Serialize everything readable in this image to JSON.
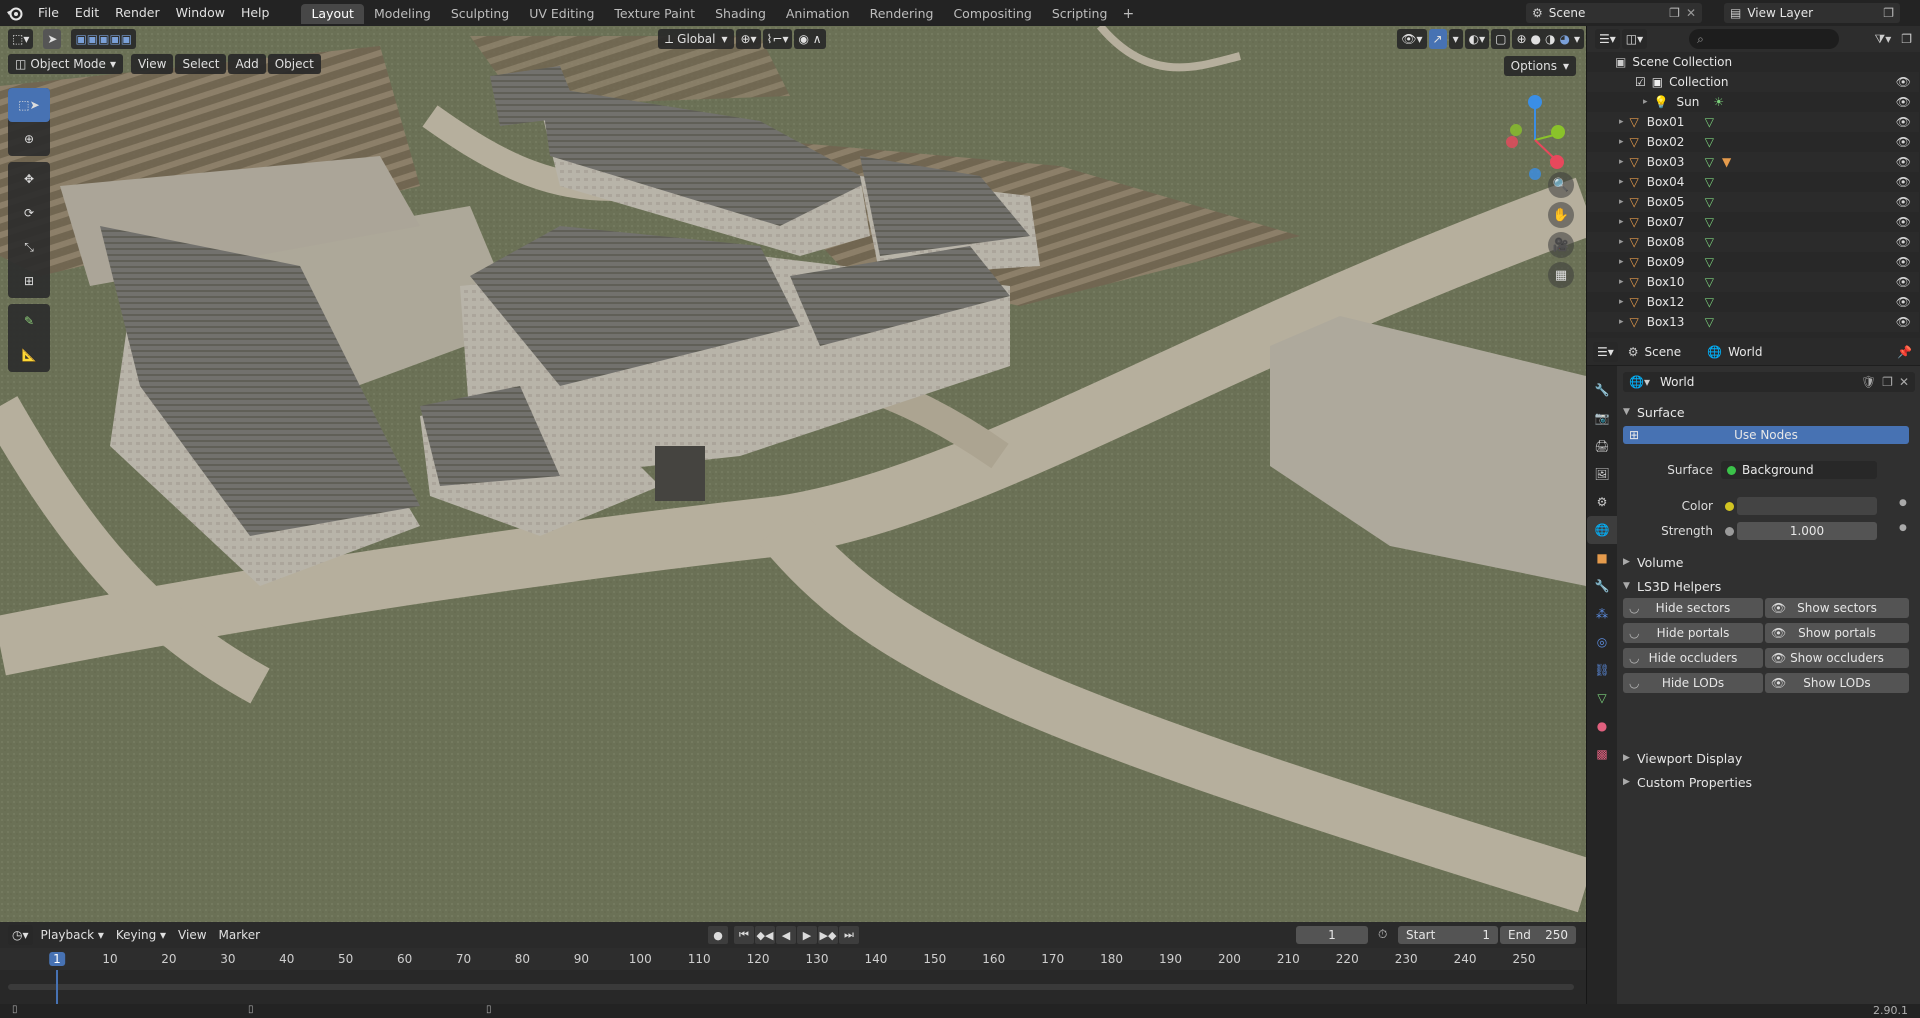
{
  "topbar": {
    "menus": [
      "File",
      "Edit",
      "Render",
      "Window",
      "Help"
    ],
    "workspaces": [
      "Layout",
      "Modeling",
      "Sculpting",
      "UV Editing",
      "Texture Paint",
      "Shading",
      "Animation",
      "Rendering",
      "Compositing",
      "Scripting"
    ],
    "active_workspace": "Layout",
    "scene_name": "Scene",
    "view_layer": "View Layer"
  },
  "viewport": {
    "mode": "Object Mode",
    "menus": [
      "View",
      "Select",
      "Add",
      "Object"
    ],
    "orientation": "Global",
    "options_label": "Options",
    "gizmo_axes": [
      "X",
      "Y",
      "Z"
    ],
    "axis_colors": {
      "x": "#e8485c",
      "y": "#8ac22a",
      "z": "#3a8ee6"
    }
  },
  "timeline": {
    "menus": [
      "Playback",
      "Keying",
      "View",
      "Marker"
    ],
    "current_frame": "1",
    "start_label": "Start",
    "start_value": "1",
    "end_label": "End",
    "end_value": "250",
    "ruler_ticks": [
      "1",
      "10",
      "20",
      "30",
      "40",
      "50",
      "60",
      "70",
      "80",
      "90",
      "100",
      "110",
      "120",
      "130",
      "140",
      "150",
      "160",
      "170",
      "180",
      "190",
      "200",
      "210",
      "220",
      "230",
      "240",
      "250"
    ],
    "tick_frames": [
      1,
      10,
      20,
      30,
      40,
      50,
      60,
      70,
      80,
      90,
      100,
      110,
      120,
      130,
      140,
      150,
      160,
      170,
      180,
      190,
      200,
      210,
      220,
      230,
      240,
      250
    ]
  },
  "outliner": {
    "search_placeholder": "",
    "scene_collection": "Scene Collection",
    "collection": "Collection",
    "sun": "Sun",
    "objects": [
      "Box01",
      "Box02",
      "Box03",
      "Box04",
      "Box05",
      "Box07",
      "Box08",
      "Box09",
      "Box10",
      "Box12",
      "Box13"
    ]
  },
  "properties": {
    "breadcrumb_scene": "Scene",
    "breadcrumb_world": "World",
    "world_name": "World",
    "panel_surface": "Surface",
    "use_nodes": "Use Nodes",
    "surface_label": "Surface",
    "surface_value": "Background",
    "color_label": "Color",
    "strength_label": "Strength",
    "strength_value": "1.000",
    "panel_volume": "Volume",
    "panel_ls3d": "LS3D Helpers",
    "ls3d_buttons": [
      {
        "hide": "Hide sectors",
        "show": "Show sectors"
      },
      {
        "hide": "Hide portals",
        "show": "Show portals"
      },
      {
        "hide": "Hide occluders",
        "show": "Show occluders"
      },
      {
        "hide": "Hide LODs",
        "show": "Show LODs"
      }
    ],
    "panel_viewport_display": "Viewport Display",
    "panel_custom_properties": "Custom Properties"
  },
  "status": {
    "version": "2.90.1"
  }
}
